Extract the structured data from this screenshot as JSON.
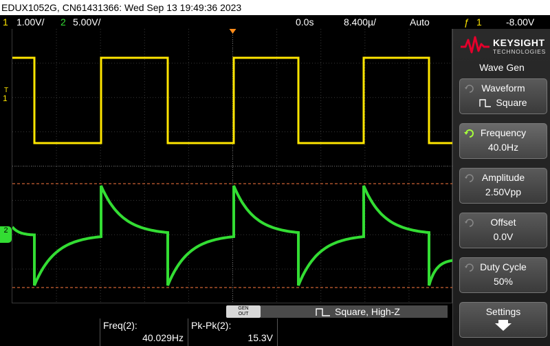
{
  "titlebar": {
    "text": "EDUX1052G, CN61431366: Wed Sep 13 19:49:36 2023"
  },
  "status": {
    "ch1_num": "1",
    "ch1_scale": "1.00V/",
    "ch2_num": "2",
    "ch2_scale": "5.00V/",
    "delay": "0.0s",
    "timebase": "8.400µ/",
    "trigger_mode": "Auto",
    "trig_icon": "ƒ",
    "trig_src": "1",
    "trig_level": "-8.00V"
  },
  "markers": {
    "ch1": "1",
    "ch2": "2",
    "trig": "T"
  },
  "brand": {
    "name": "KEYSIGHT",
    "sub": "TECHNOLOGIES"
  },
  "menu_title": "Wave Gen",
  "softkeys": [
    {
      "label": "Waveform",
      "value": "Square",
      "icon": "square-wave-icon"
    },
    {
      "label": "Frequency",
      "value": "40.0Hz",
      "icon": "knob-active-icon"
    },
    {
      "label": "Amplitude",
      "value": "2.50Vpp",
      "icon": "knob-icon"
    },
    {
      "label": "Offset",
      "value": "0.0V",
      "icon": "knob-icon"
    },
    {
      "label": "Duty Cycle",
      "value": "50%",
      "icon": "knob-icon"
    },
    {
      "label": "Settings",
      "icon": "down-arrow-icon"
    }
  ],
  "genbar": {
    "gen_label_1": "GEN",
    "gen_label_2": "OUT",
    "desc": "Square, High-Z"
  },
  "measurements": [
    {
      "label": "Freq(2):",
      "value": "40.029Hz"
    },
    {
      "label": "Pk-Pk(2):",
      "value": "15.3V"
    }
  ],
  "colors": {
    "ch1": "#ffe600",
    "ch2": "#33dd33",
    "ref_line": "#ff7a40",
    "grid": "#555555"
  }
}
